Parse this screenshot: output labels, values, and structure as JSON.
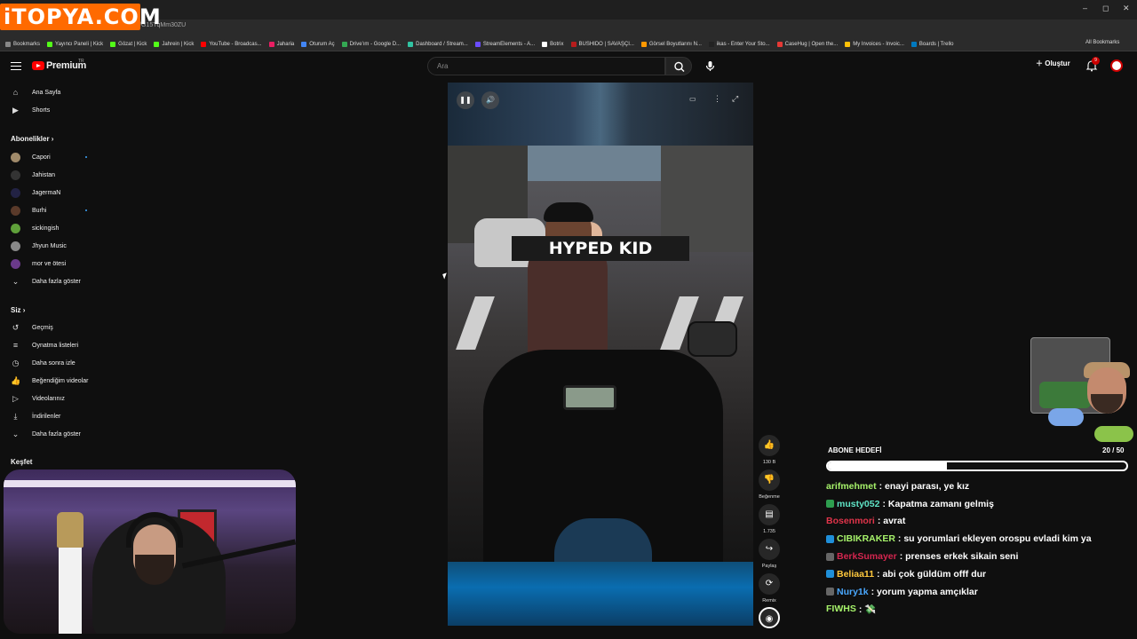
{
  "watermark": "iTOPYA.COM",
  "browser": {
    "url": "youtube.com/shorts/G15TqMm30ZU",
    "bookmarks": [
      {
        "label": "Bookmarks",
        "color": "#888888"
      },
      {
        "label": "Yayıncı Paneli | Kick",
        "color": "#53fc18"
      },
      {
        "label": "Gözat | Kick",
        "color": "#53fc18"
      },
      {
        "label": "Jahrein | Kick",
        "color": "#53fc18"
      },
      {
        "label": "YouTube - Broadcas...",
        "color": "#ff0000"
      },
      {
        "label": "Jaharia",
        "color": "#e91e63"
      },
      {
        "label": "Oturum Aç",
        "color": "#4285f4"
      },
      {
        "label": "Drive'ım - Google D...",
        "color": "#34a853"
      },
      {
        "label": "Dashboard / Stream...",
        "color": "#31c3a2"
      },
      {
        "label": "StreamElements - A...",
        "color": "#6a4cff"
      },
      {
        "label": "Botrix",
        "color": "#ffffff"
      },
      {
        "label": "BUSHIDO | SAVAŞÇI...",
        "color": "#b71c1c"
      },
      {
        "label": "Görsel Boyutlarını N...",
        "color": "#ff9800"
      },
      {
        "label": "ikas - Enter Your Sto...",
        "color": "#222222"
      },
      {
        "label": "CaseHug | Open the...",
        "color": "#e53935"
      },
      {
        "label": "My Invoices - Invoic...",
        "color": "#ffc107"
      },
      {
        "label": "Boards | Trello",
        "color": "#0079bf"
      }
    ],
    "all_bookmarks": "All Bookmarks"
  },
  "header": {
    "logo": "Premium",
    "logo_region": "TR",
    "search_placeholder": "Ara",
    "create": "Oluştur",
    "notifications": "9"
  },
  "sidebar": {
    "main": [
      {
        "label": "Ana Sayfa",
        "icon": "home-icon",
        "glyph": "⌂"
      },
      {
        "label": "Shorts",
        "icon": "shorts-icon",
        "glyph": "▶"
      }
    ],
    "subscriptions_title": "Abonelikler",
    "subscriptions": [
      {
        "label": "Capori",
        "color": "#a08a6a",
        "live": true
      },
      {
        "label": "Jahistan",
        "color": "#333333",
        "live": false
      },
      {
        "label": "JagermaN",
        "color": "#222244",
        "live": false
      },
      {
        "label": "Burhi",
        "color": "#5a3a2a",
        "live": true
      },
      {
        "label": "sickingish",
        "color": "#5fa03a",
        "live": false
      },
      {
        "label": "Jhyun Music",
        "color": "#888888",
        "live": false
      },
      {
        "label": "mor ve ötesi",
        "color": "#6a3a8a",
        "live": false
      }
    ],
    "show_more": "Daha fazla göster",
    "you_title": "Siz",
    "you": [
      {
        "label": "Geçmiş",
        "icon": "history-icon",
        "glyph": "↺"
      },
      {
        "label": "Oynatma listeleri",
        "icon": "playlist-icon",
        "glyph": "≡"
      },
      {
        "label": "Daha sonra izle",
        "icon": "clock-icon",
        "glyph": "◷"
      },
      {
        "label": "Beğendiğim videolar",
        "icon": "thumbs-up-icon",
        "glyph": "👍"
      },
      {
        "label": "Videolarınız",
        "icon": "video-icon",
        "glyph": "▷"
      },
      {
        "label": "İndirilenler",
        "icon": "download-icon",
        "glyph": "⤓"
      },
      {
        "label": "Daha fazla göster",
        "icon": "chevron-down-icon",
        "glyph": "⌄"
      }
    ],
    "explore_title": "Keşfet"
  },
  "short": {
    "caption": "HYPED KID",
    "likes": "130 B",
    "dislike_label": "Beğenme",
    "comments": "1.735",
    "share_label": "Paylaş",
    "remix_label": "Remix"
  },
  "stream": {
    "goal_title": "ABONE HEDEFİ",
    "goal_count": "20 / 50",
    "goal_progress": 0.4,
    "chat": [
      {
        "user": "arifmehmet",
        "color": "#a6f26a",
        "badge": "",
        "text": ": enayi parası, ye kız"
      },
      {
        "user": "musty052",
        "color": "#5fe3c5",
        "badge": "#2e9e4f",
        "text": ": Kapatma zamanı gelmiş"
      },
      {
        "user": "Bosenmori",
        "color": "#e0344a",
        "badge": "",
        "text": ": avrat"
      },
      {
        "user": "CIBIKRAKER",
        "color": "#a6f26a",
        "badge": "#1f8fd9",
        "text": ": su yorumlari ekleyen orospu evladi kim ya"
      },
      {
        "user": "BerkSumayer",
        "color": "#d4264f",
        "badge": "#666666",
        "text": ": prenses erkek sikain seni"
      },
      {
        "user": "Beliaa11",
        "color": "#ffc83d",
        "badge": "#1f8fd9",
        "text": ": abi çok güldüm offf dur"
      },
      {
        "user": "Nury1k",
        "color": "#4aa8ff",
        "badge": "#666666",
        "text": ": yorum yapma amçıklar"
      },
      {
        "user": "FIWHS",
        "color": "#a6f26a",
        "badge": "",
        "text": ": 💸"
      }
    ]
  }
}
